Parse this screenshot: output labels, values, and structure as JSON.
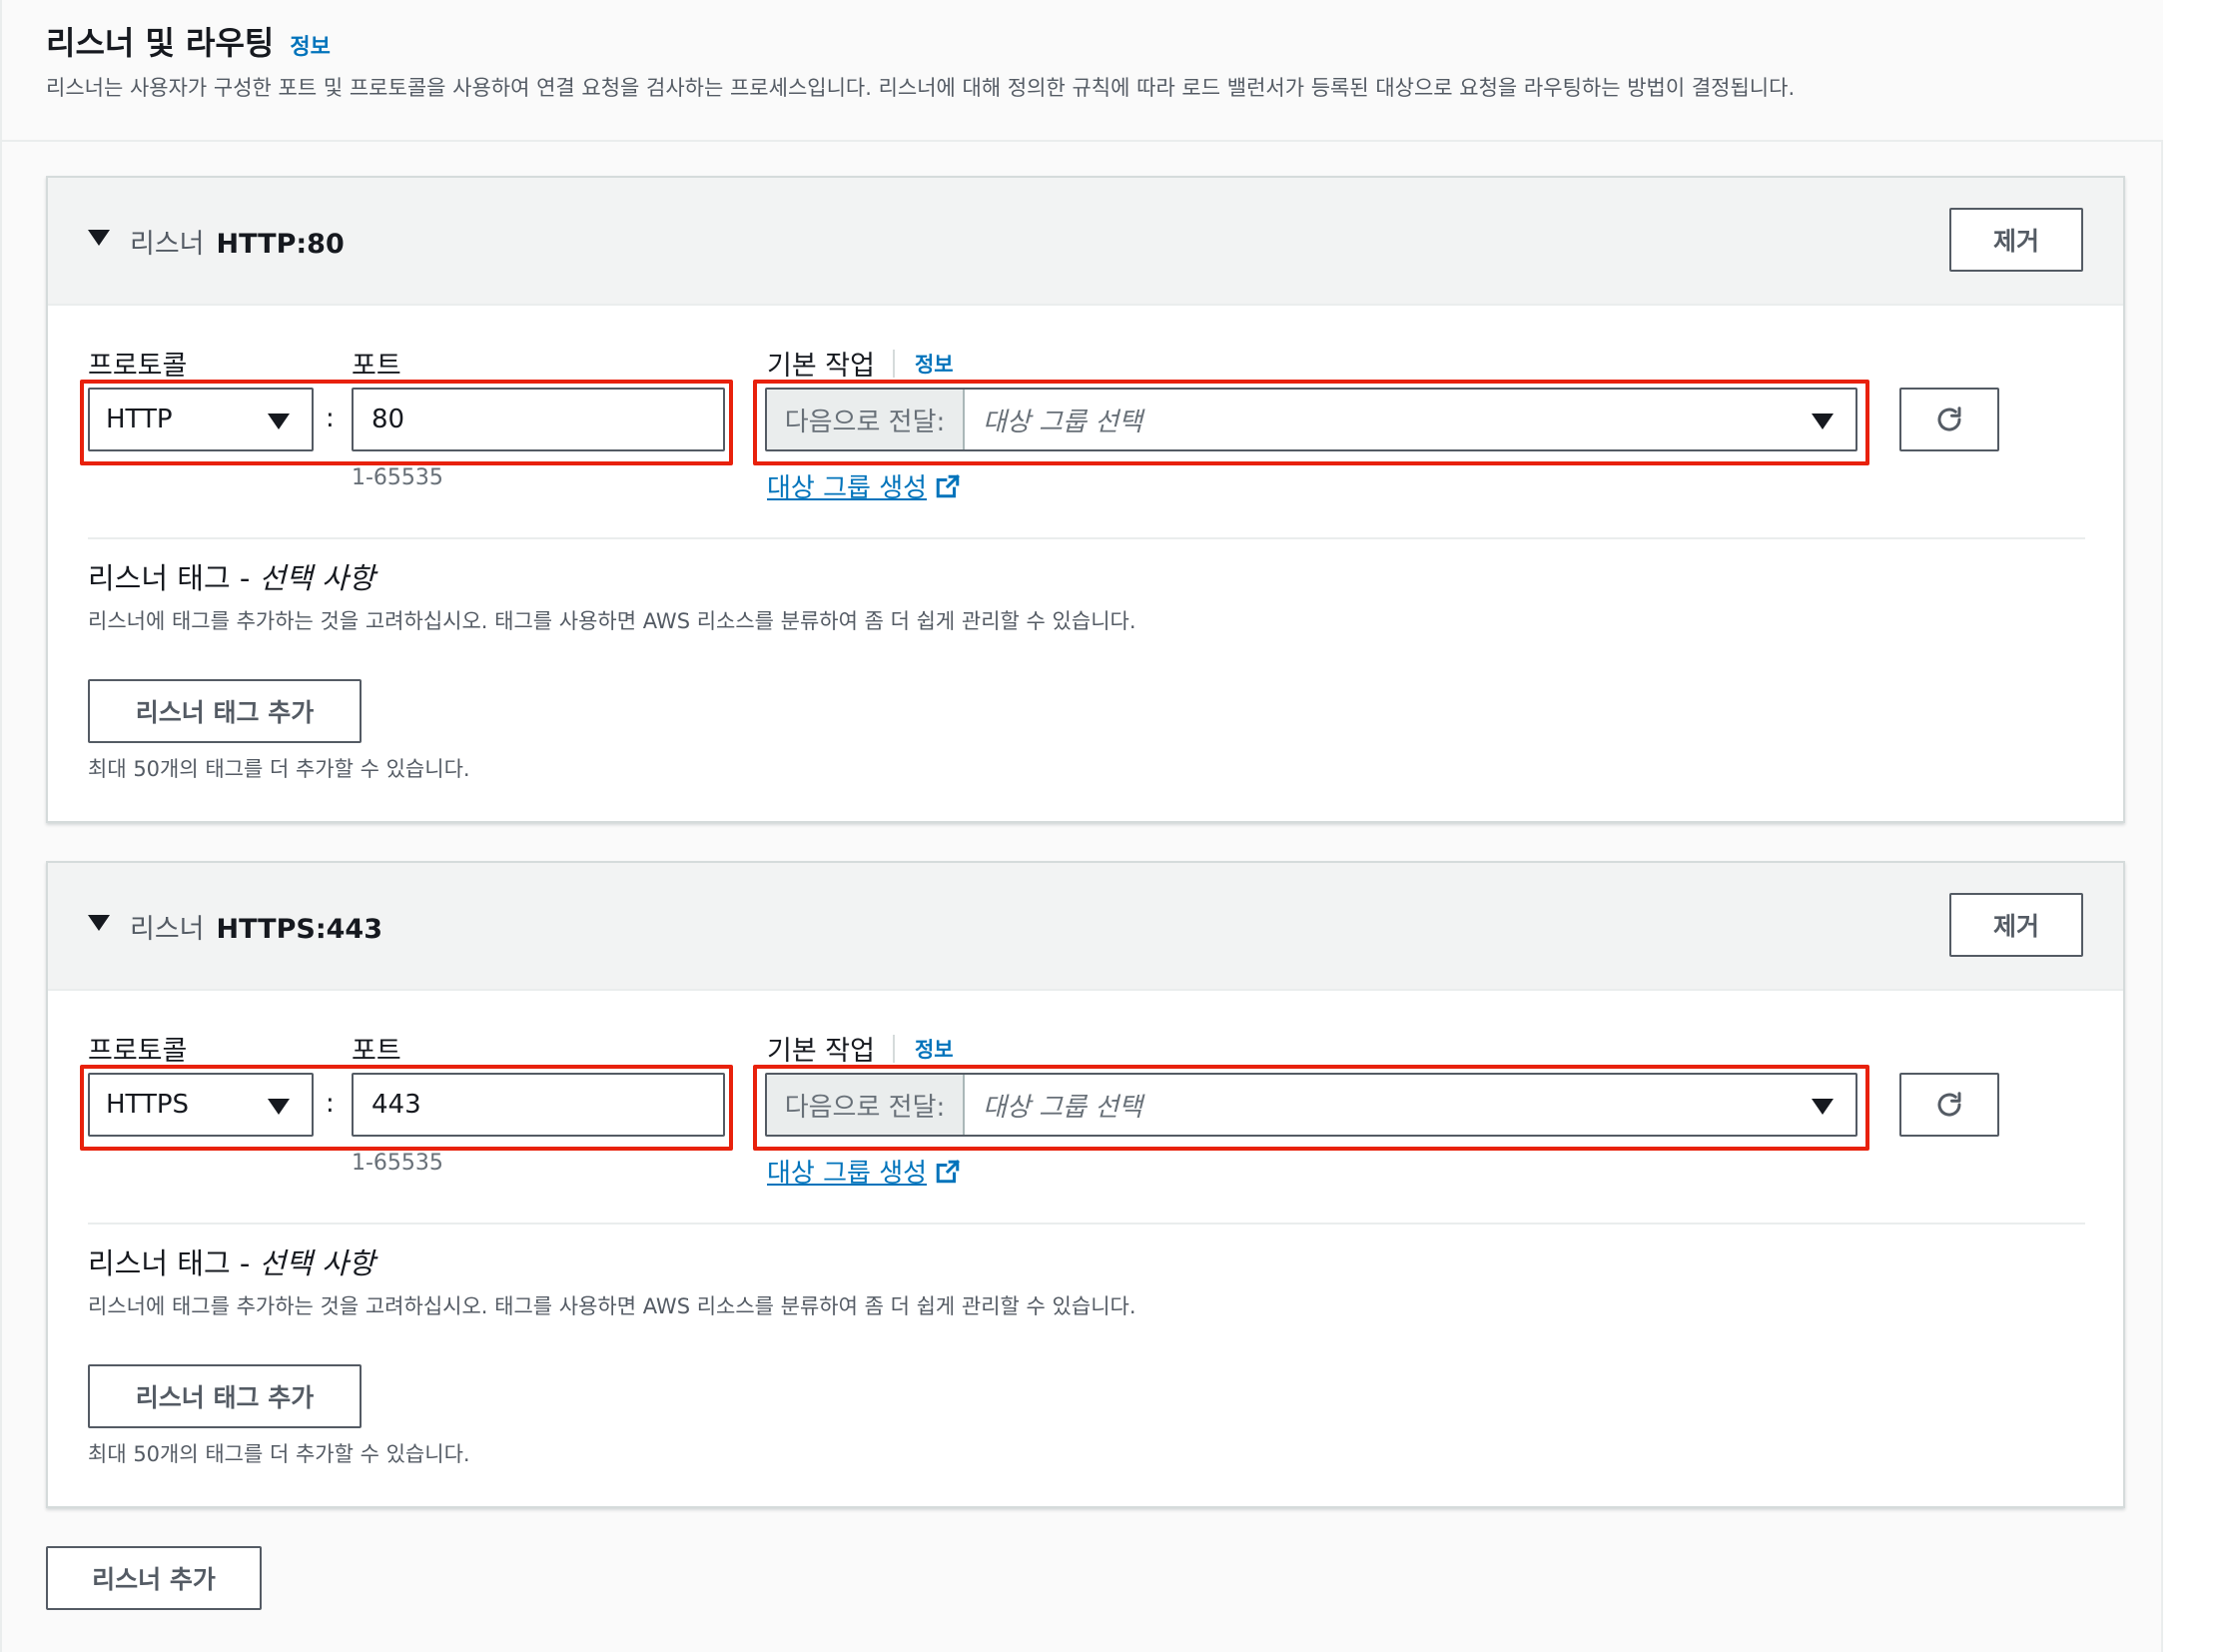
{
  "section": {
    "title": "리스너 및 라우팅",
    "info_label": "정보",
    "description": "리스너는 사용자가 구성한 포트 및 프로토콜을 사용하여 연결 요청을 검사하는 프로세스입니다. 리스너에 대해 정의한 규칙에 따라 로드 밸런서가 등록된 대상으로 요청을 라우팅하는 방법이 결정됩니다."
  },
  "listeners": [
    {
      "header_label": "리스너",
      "header_name": "HTTP:80",
      "remove_label": "제거",
      "protocol_label": "프로토콜",
      "protocol_value": "HTTP",
      "port_label": "포트",
      "port_value": "80",
      "port_hint": "1-65535",
      "action_label": "기본 작업",
      "action_info": "정보",
      "action_prefix": "다음으로 전달:",
      "target_group_placeholder": "대상 그룹 선택",
      "create_target_group": "대상 그룹 생성",
      "tags_title": "리스너 태그 -",
      "tags_title_optional": "선택 사항",
      "tags_description": "리스너에 태그를 추가하는 것을 고려하십시오. 태그를 사용하면 AWS 리소스를 분류하여 좀 더 쉽게 관리할 수 있습니다.",
      "add_tag_label": "리스너 태그 추가",
      "tag_limit": "최대 50개의 태그를 더 추가할 수 있습니다."
    },
    {
      "header_label": "리스너",
      "header_name": "HTTPS:443",
      "remove_label": "제거",
      "protocol_label": "프로토콜",
      "protocol_value": "HTTPS",
      "port_label": "포트",
      "port_value": "443",
      "port_hint": "1-65535",
      "action_label": "기본 작업",
      "action_info": "정보",
      "action_prefix": "다음으로 전달:",
      "target_group_placeholder": "대상 그룹 선택",
      "create_target_group": "대상 그룹 생성",
      "tags_title": "리스너 태그 -",
      "tags_title_optional": "선택 사항",
      "tags_description": "리스너에 태그를 추가하는 것을 고려하십시오. 태그를 사용하면 AWS 리소스를 분류하여 좀 더 쉽게 관리할 수 있습니다.",
      "add_tag_label": "리스너 태그 추가",
      "tag_limit": "최대 50개의 태그를 더 추가할 수 있습니다."
    }
  ],
  "add_listener_label": "리스너 추가",
  "icons": {
    "expand": "caret-down-icon",
    "dropdown": "chevron-down-icon",
    "refresh": "refresh-icon",
    "external": "external-link-icon"
  },
  "colors": {
    "highlight": "#e8210c",
    "link": "#0073bb",
    "text": "#16191f",
    "muted": "#545b64"
  }
}
